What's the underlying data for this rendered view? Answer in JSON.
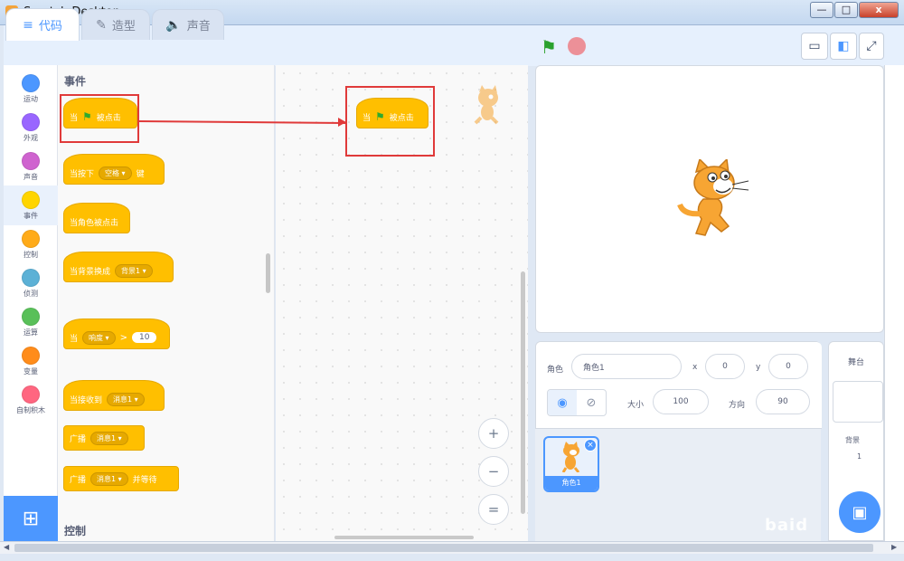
{
  "window": {
    "title": "Scratch Desktop",
    "min_label": "—",
    "max_label": "□",
    "close_label": "x"
  },
  "tabs": [
    {
      "label": "代码",
      "icon": "code-icon"
    },
    {
      "label": "造型",
      "icon": "brush-icon"
    },
    {
      "label": "声音",
      "icon": "speaker-icon"
    }
  ],
  "controls": {
    "green_flag": "green-flag-icon",
    "stop": "stop-icon"
  },
  "categories": [
    {
      "label": "运动",
      "color": "#4c97ff"
    },
    {
      "label": "外观",
      "color": "#9966ff"
    },
    {
      "label": "声音",
      "color": "#cf63cf"
    },
    {
      "label": "事件",
      "color": "#ffd500"
    },
    {
      "label": "控制",
      "color": "#ffab19"
    },
    {
      "label": "侦测",
      "color": "#5cb1d6"
    },
    {
      "label": "运算",
      "color": "#59c059"
    },
    {
      "label": "变量",
      "color": "#ff8c1a"
    },
    {
      "label": "自制积木",
      "color": "#ff6680"
    }
  ],
  "palette": {
    "section_events": "事件",
    "section_control": "控制",
    "block_flag_when": "当",
    "block_flag_clicked": "被点击",
    "block_key_pre": "当按下",
    "block_key_value": "空格 ▾",
    "block_key_post": "键",
    "block_sprite_clicked": "当角色被点击",
    "block_backdrop_pre": "当背景换成",
    "block_backdrop_value": "背景1 ▾",
    "block_loud_pre": "当",
    "block_loud_value": "响度 ▾",
    "block_loud_op": ">",
    "block_loud_num": "10",
    "block_receive_pre": "当接收到",
    "block_receive_value": "消息1 ▾",
    "block_broadcast_pre": "广播",
    "block_broadcast_value": "消息1 ▾",
    "block_broadcast_wait_pre": "广播",
    "block_broadcast_wait_value": "消息1 ▾",
    "block_broadcast_wait_post": "并等待"
  },
  "script_area": {
    "block_when": "当",
    "block_clicked": "被点击",
    "zoom_in": "+",
    "zoom_out": "−",
    "zoom_reset": "="
  },
  "sprite_info": {
    "sprite_label": "角色",
    "sprite_name": "角色1",
    "x_label": "x",
    "x_value": "0",
    "y_label": "y",
    "y_value": "0",
    "size_label": "大小",
    "size_value": "100",
    "direction_label": "方向",
    "direction_value": "90",
    "tile_name": "角色1",
    "delete_label": "×"
  },
  "stage_pane": {
    "title": "舞台",
    "backdrops_label": "背景",
    "backdrops_count": "1"
  },
  "watermark": "baid"
}
